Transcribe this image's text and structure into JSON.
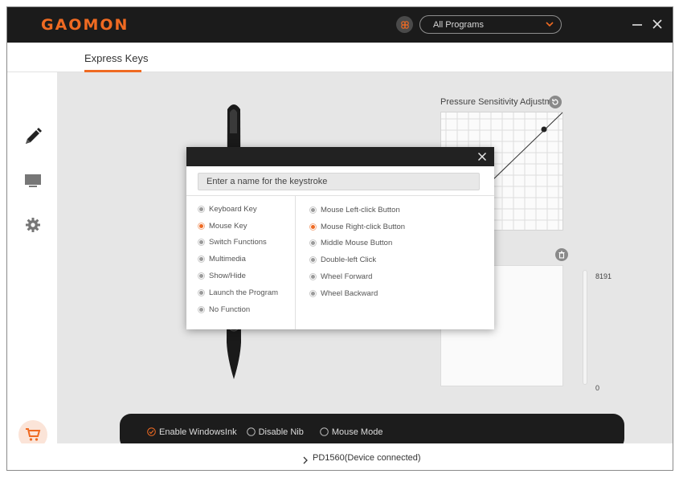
{
  "app": {
    "logo": "GAOMON",
    "program_select": "All Programs",
    "accent": "#ef6a22"
  },
  "tabs": [
    {
      "label": "Express Keys",
      "active": true
    }
  ],
  "sidebar": {
    "items": [
      {
        "icon": "pen-icon"
      },
      {
        "icon": "monitor-icon"
      },
      {
        "icon": "gear-icon"
      }
    ],
    "cart_icon": "cart-icon"
  },
  "pressure": {
    "title": "Pressure Sensitivity Adjustm...",
    "max_label": "8191",
    "min_label": "0"
  },
  "pen_options": [
    {
      "label": "Enable WindowsInk",
      "checked": true
    },
    {
      "label": "Disable Nib",
      "checked": false
    },
    {
      "label": "Mouse Mode",
      "checked": false
    }
  ],
  "status": {
    "text": "PD1560(Device connected)"
  },
  "dialog": {
    "name_placeholder": "Enter a name for the keystroke",
    "categories": [
      {
        "label": "Keyboard Key",
        "selected": false
      },
      {
        "label": "Mouse Key",
        "selected": true
      },
      {
        "label": "Switch Functions",
        "selected": false
      },
      {
        "label": "Multimedia",
        "selected": false
      },
      {
        "label": "Show/Hide",
        "selected": false
      },
      {
        "label": "Launch the Program",
        "selected": false
      },
      {
        "label": "No Function",
        "selected": false
      }
    ],
    "mouse_options": [
      {
        "label": "Mouse Left-click Button",
        "selected": false
      },
      {
        "label": "Mouse Right-click Button",
        "selected": true
      },
      {
        "label": "Middle Mouse Button",
        "selected": false
      },
      {
        "label": "Double-left Click",
        "selected": false
      },
      {
        "label": "Wheel Forward",
        "selected": false
      },
      {
        "label": "Wheel Backward",
        "selected": false
      }
    ]
  }
}
